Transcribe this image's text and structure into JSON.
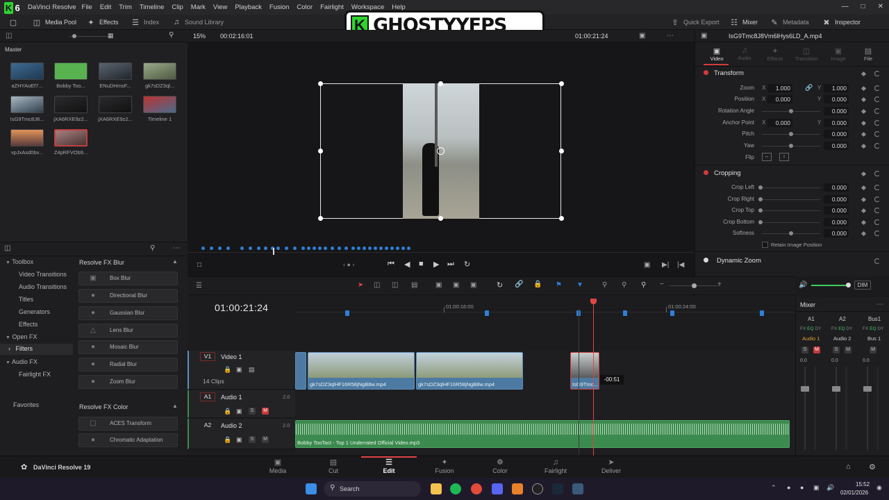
{
  "app": {
    "name": "DaVinci Resolve",
    "version_label": "DaVinci Resolve 19"
  },
  "menu": [
    "File",
    "Edit",
    "Trim",
    "Timeline",
    "Clip",
    "Mark",
    "View",
    "Playback",
    "Fusion",
    "Color",
    "Fairlight",
    "Workspace",
    "Help"
  ],
  "overlay_logo": {
    "badge": "K6",
    "text": "GHOSTYYFPS"
  },
  "toolbar": {
    "media_pool": "Media Pool",
    "effects": "Effects",
    "index": "Index",
    "sound_library": "Sound Library",
    "quick_export": "Quick Export",
    "mixer": "Mixer",
    "metadata": "Metadata",
    "inspector": "Inspector"
  },
  "viewer": {
    "zoom": "15%",
    "duration": "00:02:16:01",
    "timecode": "01:00:21:24",
    "clip_name": "IsG9Tmc8J8Vm6lHys6LD_A.mp4"
  },
  "media_pool": {
    "bin": "Master",
    "items": [
      {
        "label": "aZHYAoEf7..."
      },
      {
        "label": "Bobby Too..."
      },
      {
        "label": "ENuDHmsF..."
      },
      {
        "label": "gk7sDZ3ql..."
      },
      {
        "label": "IsG9Tmc8J8..."
      },
      {
        "label": "jXA6RXE9z2..."
      },
      {
        "label": "jXA6RXE9z2..."
      },
      {
        "label": "Timeline 1"
      },
      {
        "label": "vpJxAsd0bv..."
      },
      {
        "label": "Z4pRFVOb9..."
      }
    ]
  },
  "inspector": {
    "tabs": [
      "Video",
      "Audio",
      "Effects",
      "Transition",
      "Image",
      "File"
    ],
    "transform": {
      "title": "Transform",
      "zoom_label": "Zoom",
      "zoom_x": "1.000",
      "zoom_y": "1.000",
      "position_label": "Position",
      "pos_x": "0.000",
      "pos_y": "0.000",
      "rotation_label": "Rotation Angle",
      "rotation": "0.000",
      "anchor_label": "Anchor Point",
      "anchor_x": "0.000",
      "anchor_y": "0.000",
      "pitch_label": "Pitch",
      "pitch": "0.000",
      "yaw_label": "Yaw",
      "yaw": "0.000",
      "flip_label": "Flip",
      "x": "X",
      "y": "Y"
    },
    "cropping": {
      "title": "Cropping",
      "left_label": "Crop Left",
      "left": "0.000",
      "right_label": "Crop Right",
      "right": "0.000",
      "top_label": "Crop Top",
      "top": "0.000",
      "bottom_label": "Crop Bottom",
      "bottom": "0.000",
      "softness_label": "Softness",
      "softness": "0.000",
      "retain_label": "Retain Image Position"
    },
    "dynamic_zoom": "Dynamic Zoom"
  },
  "effects_panel": {
    "tree": [
      "Toolbox",
      "Video Transitions",
      "Audio Transitions",
      "Titles",
      "Generators",
      "Effects",
      "Open FX",
      "Filters",
      "Audio FX",
      "Fairlight FX",
      "Favorites"
    ],
    "blur_header": "Resolve FX Blur",
    "blur_items": [
      "Box Blur",
      "Directional Blur",
      "Gaussian Blur",
      "Lens Blur",
      "Mosaic Blur",
      "Radial Blur",
      "Zoom Blur"
    ],
    "color_header": "Resolve FX Color",
    "color_items": [
      "ACES Transform",
      "Chromatic Adaptation"
    ]
  },
  "timeline": {
    "timecode": "01:00:21:24",
    "ruler": [
      "01:00:16:00",
      "01:00:24:00"
    ],
    "tracks": {
      "v1": {
        "tag": "V1",
        "name": "Video 1",
        "count": "14 Clips"
      },
      "a1": {
        "tag": "A1",
        "name": "Audio 1",
        "level": "2.0"
      },
      "a2": {
        "tag": "A2",
        "name": "Audio 2",
        "level": "2.0"
      }
    },
    "clips": {
      "c1": "gk7sDZ3qlHF16R58jNgB8w.mp4",
      "c2": "gk7sDZ3qlHF16R58jNgB8w.mp4",
      "c3": "IsG9Tmc...",
      "audio": "Bobby TooTact - Top 1 Underrated Official Video.mp3"
    },
    "tooltip": "-00:51",
    "dim": "DIM"
  },
  "mixer": {
    "title": "Mixer",
    "channels": [
      "A1",
      "A2",
      "Bus1"
    ],
    "names": [
      "Audio 1",
      "Audio 2",
      "Bus 1"
    ],
    "level": "0.0"
  },
  "pages": [
    "Media",
    "Cut",
    "Edit",
    "Fusion",
    "Color",
    "Fairlight",
    "Deliver"
  ],
  "taskbar": {
    "search": "Search",
    "time": "15:52",
    "date": "02/01/2026"
  }
}
